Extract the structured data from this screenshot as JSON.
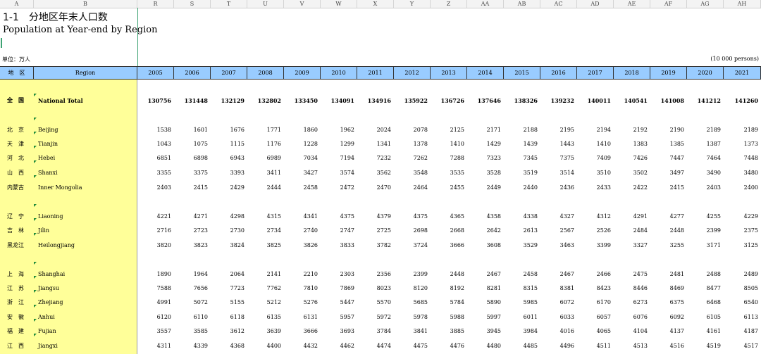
{
  "column_letters": [
    "A",
    "B",
    "R",
    "S",
    "T",
    "U",
    "V",
    "W",
    "X",
    "Y",
    "Z",
    "AA",
    "AB",
    "AC",
    "AD",
    "AE",
    "AF",
    "AG",
    "AH"
  ],
  "title_cn": "1-1　分地区年末人口数",
  "title_en": "Population at Year-end by Region",
  "unit_cn": "单位：万人",
  "unit_en": "(10 000 persons)",
  "header": {
    "region_cn": "地　区",
    "region_en": "Region",
    "years": [
      "2005",
      "2006",
      "2007",
      "2008",
      "2009",
      "2010",
      "2011",
      "2012",
      "2013",
      "2014",
      "2015",
      "2016",
      "2017",
      "2018",
      "2019",
      "2020",
      "2021"
    ]
  },
  "rows": [
    {
      "cn": "全　国",
      "en": "National Total",
      "values": [
        "130756",
        "131448",
        "132129",
        "132802",
        "133450",
        "134091",
        "134916",
        "135922",
        "136726",
        "137646",
        "138326",
        "139232",
        "140011",
        "140541",
        "141008",
        "141212",
        "141260"
      ]
    },
    {
      "cn": "北　京",
      "en": "Beijing",
      "values": [
        "1538",
        "1601",
        "1676",
        "1771",
        "1860",
        "1962",
        "2024",
        "2078",
        "2125",
        "2171",
        "2188",
        "2195",
        "2194",
        "2192",
        "2190",
        "2189",
        "2189"
      ]
    },
    {
      "cn": "天　津",
      "en": "Tianjin",
      "values": [
        "1043",
        "1075",
        "1115",
        "1176",
        "1228",
        "1299",
        "1341",
        "1378",
        "1410",
        "1429",
        "1439",
        "1443",
        "1410",
        "1383",
        "1385",
        "1387",
        "1373"
      ]
    },
    {
      "cn": "河　北",
      "en": "Hebei",
      "values": [
        "6851",
        "6898",
        "6943",
        "6989",
        "7034",
        "7194",
        "7232",
        "7262",
        "7288",
        "7323",
        "7345",
        "7375",
        "7409",
        "7426",
        "7447",
        "7464",
        "7448"
      ]
    },
    {
      "cn": "山　西",
      "en": "Shanxi",
      "values": [
        "3355",
        "3375",
        "3393",
        "3411",
        "3427",
        "3574",
        "3562",
        "3548",
        "3535",
        "3528",
        "3519",
        "3514",
        "3510",
        "3502",
        "3497",
        "3490",
        "3480"
      ]
    },
    {
      "cn": "内蒙古",
      "en": "Inner Mongolia",
      "values": [
        "2403",
        "2415",
        "2429",
        "2444",
        "2458",
        "2472",
        "2470",
        "2464",
        "2455",
        "2449",
        "2440",
        "2436",
        "2433",
        "2422",
        "2415",
        "2403",
        "2400"
      ]
    },
    {
      "cn": "辽　宁",
      "en": "Liaoning",
      "values": [
        "4221",
        "4271",
        "4298",
        "4315",
        "4341",
        "4375",
        "4379",
        "4375",
        "4365",
        "4358",
        "4338",
        "4327",
        "4312",
        "4291",
        "4277",
        "4255",
        "4229"
      ]
    },
    {
      "cn": "吉　林",
      "en": "Jilin",
      "values": [
        "2716",
        "2723",
        "2730",
        "2734",
        "2740",
        "2747",
        "2725",
        "2698",
        "2668",
        "2642",
        "2613",
        "2567",
        "2526",
        "2484",
        "2448",
        "2399",
        "2375"
      ]
    },
    {
      "cn": "黑龙江",
      "en": "Heilongjiang",
      "values": [
        "3820",
        "3823",
        "3824",
        "3825",
        "3826",
        "3833",
        "3782",
        "3724",
        "3666",
        "3608",
        "3529",
        "3463",
        "3399",
        "3327",
        "3255",
        "3171",
        "3125"
      ]
    },
    {
      "cn": "上　海",
      "en": "Shanghai",
      "values": [
        "1890",
        "1964",
        "2064",
        "2141",
        "2210",
        "2303",
        "2356",
        "2399",
        "2448",
        "2467",
        "2458",
        "2467",
        "2466",
        "2475",
        "2481",
        "2488",
        "2489"
      ]
    },
    {
      "cn": "江　苏",
      "en": "Jiangsu",
      "values": [
        "7588",
        "7656",
        "7723",
        "7762",
        "7810",
        "7869",
        "8023",
        "8120",
        "8192",
        "8281",
        "8315",
        "8381",
        "8423",
        "8446",
        "8469",
        "8477",
        "8505"
      ]
    },
    {
      "cn": "浙　江",
      "en": "Zhejiang",
      "values": [
        "4991",
        "5072",
        "5155",
        "5212",
        "5276",
        "5447",
        "5570",
        "5685",
        "5784",
        "5890",
        "5985",
        "6072",
        "6170",
        "6273",
        "6375",
        "6468",
        "6540"
      ]
    },
    {
      "cn": "安　徽",
      "en": "Anhui",
      "values": [
        "6120",
        "6110",
        "6118",
        "6135",
        "6131",
        "5957",
        "5972",
        "5978",
        "5988",
        "5997",
        "6011",
        "6033",
        "6057",
        "6076",
        "6092",
        "6105",
        "6113"
      ]
    },
    {
      "cn": "福　建",
      "en": "Fujian",
      "values": [
        "3557",
        "3585",
        "3612",
        "3639",
        "3666",
        "3693",
        "3784",
        "3841",
        "3885",
        "3945",
        "3984",
        "4016",
        "4065",
        "4104",
        "4137",
        "4161",
        "4187"
      ]
    },
    {
      "cn": "江　西",
      "en": "Jiangxi",
      "values": [
        "4311",
        "4339",
        "4368",
        "4400",
        "4432",
        "4462",
        "4474",
        "4475",
        "4476",
        "4480",
        "4485",
        "4496",
        "4511",
        "4513",
        "4516",
        "4519",
        "4517"
      ]
    }
  ],
  "colors": {
    "header_bg": "#99ccff",
    "region_bg": "#ffff99",
    "marker": "#1e8a3a",
    "selection": "#3ea374"
  }
}
